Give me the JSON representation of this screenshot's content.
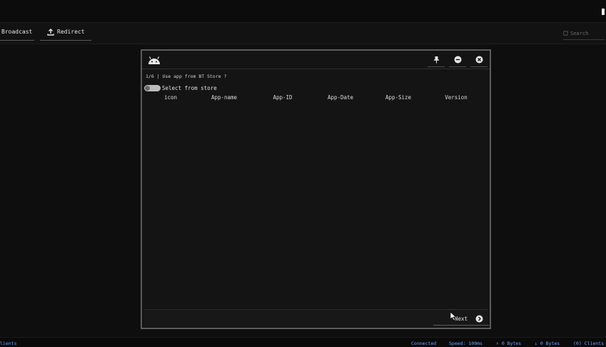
{
  "toolbar": {
    "broadcast_label": "Broadcast",
    "redirect_label": "Redirect",
    "search_placeholder": "Search"
  },
  "dialog": {
    "header_icon": "android-icon",
    "header_buttons": [
      "pin-icon",
      "minimize-icon",
      "close-icon"
    ],
    "step_text": "1/6 | Use app from BT Store ?",
    "toggle_label": "Select from store",
    "toggle_on": false,
    "columns": [
      "icon",
      "App-name",
      "App-ID",
      "App-Date",
      "App-Size",
      "Version"
    ],
    "rows": [],
    "next_label": "Next",
    "next_icon": "arrow-right-circle-icon"
  },
  "statusbar": {
    "clients_left": "lients",
    "connection": "Connected",
    "speed": "Speed: 109ms",
    "upload": "↑ 0 Bytes",
    "download": "↓ 0 Bytes",
    "clients_count": "(0) Clients"
  },
  "colors": {
    "background": "#0e0e0e",
    "dialog_bg": "#141414",
    "dialog_border": "#5c5c5c",
    "status_text": "#6ea6ff"
  }
}
